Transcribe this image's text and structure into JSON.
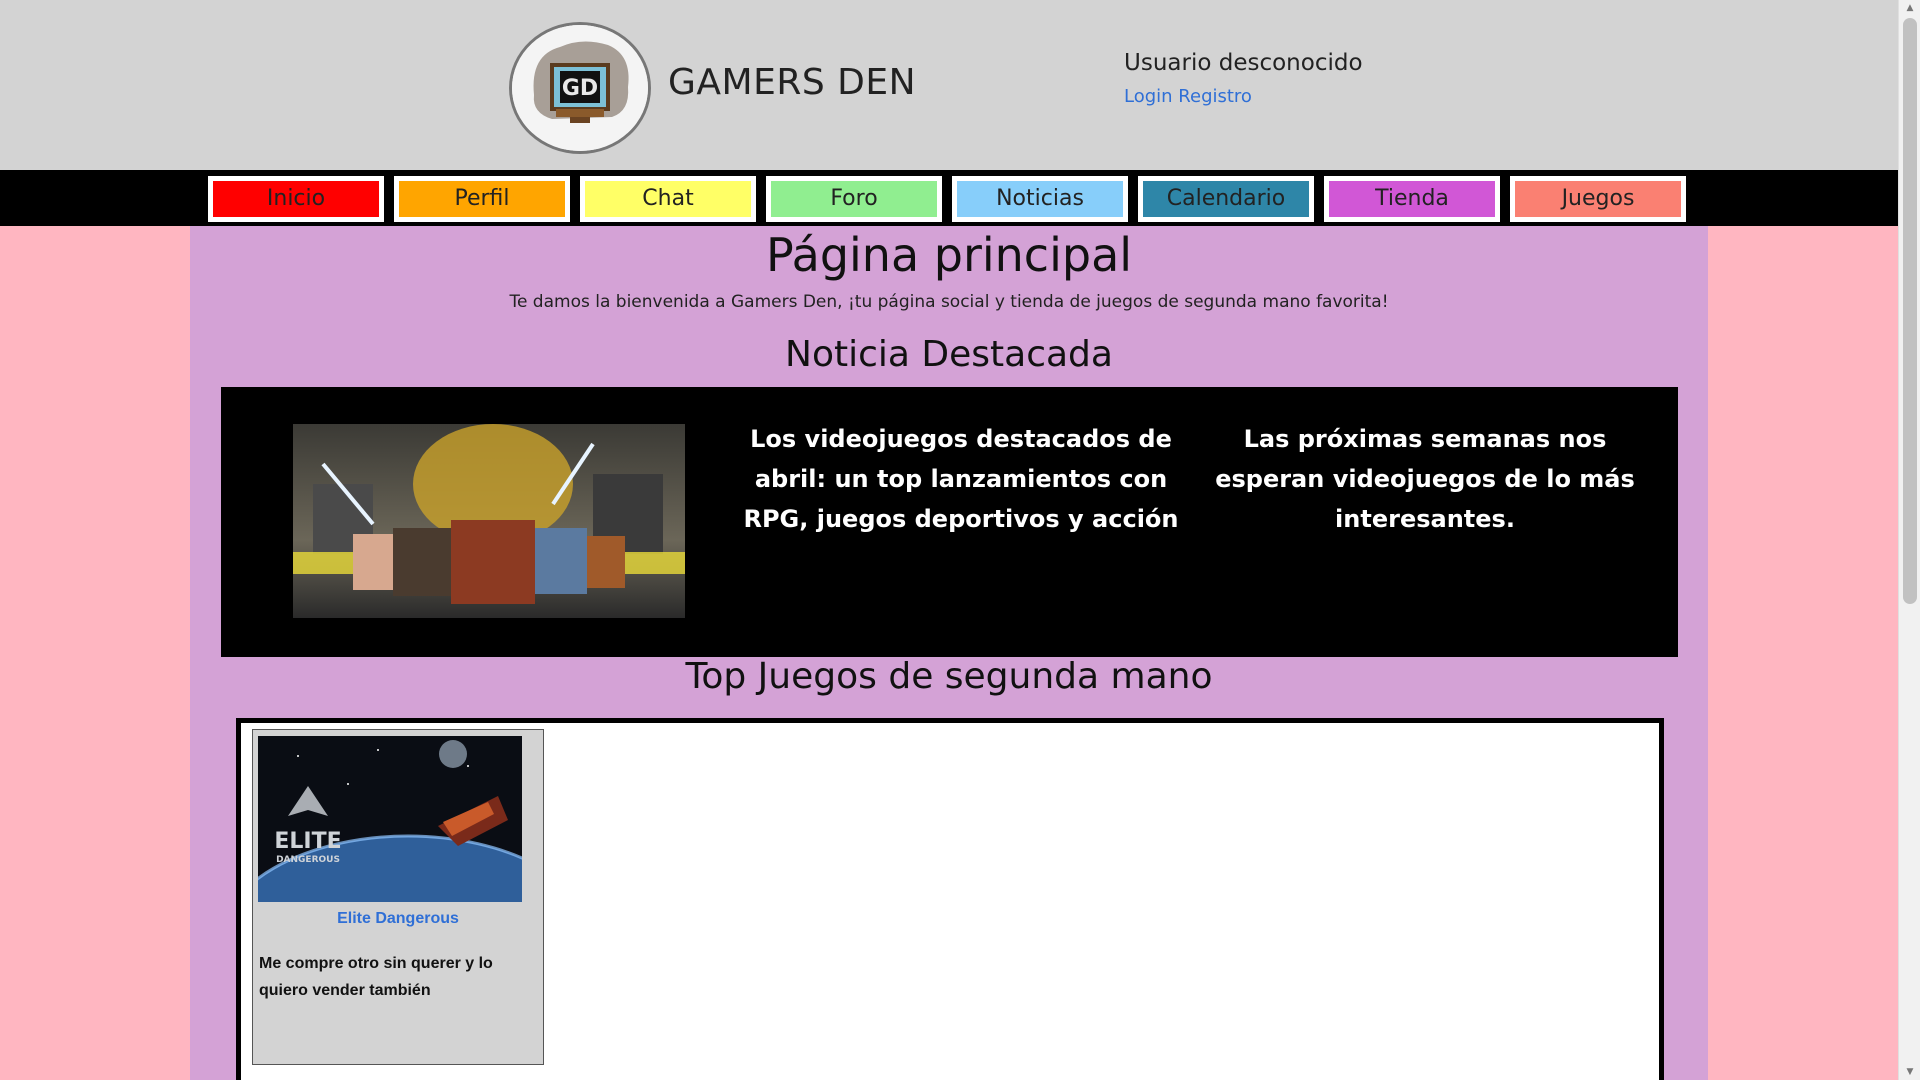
{
  "header": {
    "site_name": "GAMERS DEN",
    "logo_letters": "GD",
    "user_status": "Usuario desconocido",
    "login_label": "Login",
    "register_label": "Registro"
  },
  "nav": {
    "items": [
      {
        "label": "Inicio",
        "color": "#ff0000"
      },
      {
        "label": "Perfil",
        "color": "#ffa500"
      },
      {
        "label": "Chat",
        "color": "#ffff66"
      },
      {
        "label": "Foro",
        "color": "#90ee90"
      },
      {
        "label": "Noticias",
        "color": "#87cefa"
      },
      {
        "label": "Calendario",
        "color": "#2e86a8"
      },
      {
        "label": "Tienda",
        "color": "#d157d6"
      },
      {
        "label": "Juegos",
        "color": "#fa8072"
      }
    ]
  },
  "main": {
    "page_title": "Página principal",
    "welcome": "Te damos la bienvenida a Gamers Den, ¡tu página social y tienda de juegos de segunda mano favorita!",
    "featured_title": "Noticia Destacada",
    "featured_news": {
      "headline": "Los videojuegos destacados de abril: un top lanzamientos con RPG, juegos deportivos y acción",
      "summary": "Las próximas semanas nos esperan videojuegos de lo más interesantes."
    },
    "top_games_title": "Top Juegos de segunda mano",
    "games": [
      {
        "name": "Elite Dangerous",
        "description": "Me compre otro sin querer y lo quiero vender también",
        "image_logo_line1": "ELITE",
        "image_logo_line2": "DANGEROUS"
      }
    ]
  },
  "colors": {
    "page_bg": "#ffb6c1",
    "header_bg": "#d3d3d3",
    "main_bg": "#d4a2d6",
    "link": "#2f6fd6"
  }
}
